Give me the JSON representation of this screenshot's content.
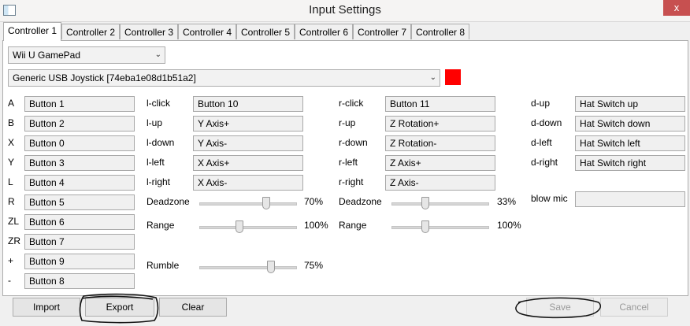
{
  "window": {
    "title": "Input Settings",
    "close_glyph": "x"
  },
  "tabs": [
    "Controller 1",
    "Controller 2",
    "Controller 3",
    "Controller 4",
    "Controller 5",
    "Controller 6",
    "Controller 7",
    "Controller 8"
  ],
  "controller_type": "Wii U GamePad",
  "device": "Generic   USB  Joystick  [74eba1e08d1b51a2]",
  "device_color": "#ff0000",
  "buttons_left": [
    {
      "label": "A",
      "value": "Button 1"
    },
    {
      "label": "B",
      "value": "Button 2"
    },
    {
      "label": "X",
      "value": "Button 0"
    },
    {
      "label": "Y",
      "value": "Button 3"
    },
    {
      "label": "L",
      "value": "Button 4"
    },
    {
      "label": "R",
      "value": "Button 5"
    },
    {
      "label": "ZL",
      "value": "Button 6"
    },
    {
      "label": "ZR",
      "value": "Button 7"
    },
    {
      "label": "+",
      "value": "Button 9"
    },
    {
      "label": "-",
      "value": "Button 8"
    }
  ],
  "left_stick": [
    {
      "label": "l-click",
      "value": "Button 10"
    },
    {
      "label": "l-up",
      "value": "Y Axis+"
    },
    {
      "label": "l-down",
      "value": "Y Axis-"
    },
    {
      "label": "l-left",
      "value": "X Axis+"
    },
    {
      "label": "l-right",
      "value": "X Axis-"
    }
  ],
  "right_stick": [
    {
      "label": "r-click",
      "value": "Button 11"
    },
    {
      "label": "r-up",
      "value": "Z Rotation+"
    },
    {
      "label": "r-down",
      "value": "Z Rotation-"
    },
    {
      "label": "r-left",
      "value": "Z Axis+"
    },
    {
      "label": "r-right",
      "value": "Z Axis-"
    }
  ],
  "dpad": [
    {
      "label": "d-up",
      "value": "Hat Switch up"
    },
    {
      "label": "d-down",
      "value": "Hat Switch down"
    },
    {
      "label": "d-left",
      "value": "Hat Switch left"
    },
    {
      "label": "d-right",
      "value": "Hat Switch right"
    }
  ],
  "blow_mic": {
    "label": "blow mic",
    "value": ""
  },
  "left_sliders": {
    "deadzone": {
      "label": "Deadzone",
      "value": 70,
      "text": "70%"
    },
    "range": {
      "label": "Range",
      "value": 40,
      "text": "100%"
    },
    "rumble": {
      "label": "Rumble",
      "value": 75,
      "text": "75%"
    }
  },
  "right_sliders": {
    "deadzone": {
      "label": "Deadzone",
      "value": 33,
      "text": "33%"
    },
    "range": {
      "label": "Range",
      "value": 33,
      "text": "100%"
    }
  },
  "buttons": {
    "import": "Import",
    "export": "Export",
    "clear": "Clear",
    "save": "Save",
    "cancel": "Cancel"
  }
}
